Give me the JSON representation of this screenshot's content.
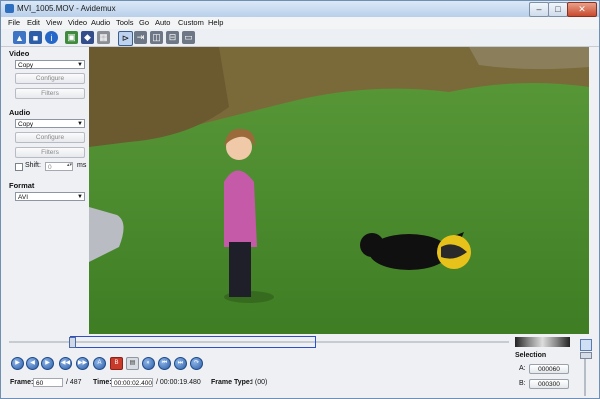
{
  "window": {
    "title": "MVI_1005.MOV - Avidemux"
  },
  "menu": [
    "File",
    "Edit",
    "View",
    "Video",
    "Audio",
    "Tools",
    "Go",
    "Auto",
    "Custom",
    "Help"
  ],
  "left_panel": {
    "video": {
      "heading": "Video",
      "codec": "Copy",
      "configure": "Configure",
      "filters": "Filters"
    },
    "audio": {
      "heading": "Audio",
      "codec": "Copy",
      "configure": "Configure",
      "filters": "Filters",
      "shift_label": "Shift:",
      "shift_value": "0",
      "shift_unit": "ms"
    },
    "format": {
      "heading": "Format",
      "value": "AVI"
    }
  },
  "status": {
    "frame_label": "Frame:",
    "frame_value": "60",
    "frame_total": "/ 487",
    "time_label": "Time:",
    "time_value": "00:00:02.400",
    "time_total": "/ 00:00:19.480",
    "frame_type_label": "Frame Type:",
    "frame_type_value": "I (00)"
  },
  "selection": {
    "heading": "Selection",
    "a_label": "A:",
    "a_value": "000060",
    "b_label": "B:",
    "b_value": "000300"
  },
  "playback": {
    "position_fraction": 0.123
  }
}
